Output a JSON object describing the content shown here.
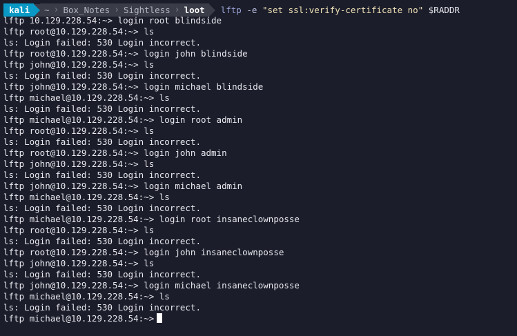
{
  "prompt": {
    "user": "kali",
    "path": [
      "~",
      "Box_Notes",
      "Sightless"
    ],
    "current_dir": "loot",
    "command": "lftp",
    "flag": "-e",
    "argument": "\"set ssl:verify-certificate no\"",
    "variable": "$RADDR"
  },
  "lines": [
    "lftp 10.129.228.54:~> login root blindside",
    "lftp root@10.129.228.54:~> ls",
    "ls: Login failed: 530 Login incorrect.",
    "lftp root@10.129.228.54:~> login john blindside",
    "lftp john@10.129.228.54:~> ls",
    "ls: Login failed: 530 Login incorrect.",
    "lftp john@10.129.228.54:~> login michael blindside",
    "lftp michael@10.129.228.54:~> ls",
    "ls: Login failed: 530 Login incorrect.",
    "lftp michael@10.129.228.54:~> login root admin",
    "lftp root@10.129.228.54:~> ls",
    "ls: Login failed: 530 Login incorrect.",
    "lftp root@10.129.228.54:~> login john admin",
    "lftp john@10.129.228.54:~> ls",
    "ls: Login failed: 530 Login incorrect.",
    "lftp john@10.129.228.54:~> login michael admin",
    "lftp michael@10.129.228.54:~> ls",
    "ls: Login failed: 530 Login incorrect.",
    "lftp michael@10.129.228.54:~> login root insaneclownposse",
    "lftp root@10.129.228.54:~> ls",
    "ls: Login failed: 530 Login incorrect.",
    "lftp root@10.129.228.54:~> login john insaneclownposse",
    "lftp john@10.129.228.54:~> ls",
    "ls: Login failed: 530 Login incorrect.",
    "lftp john@10.129.228.54:~> login michael insaneclownposse",
    "lftp michael@10.129.228.54:~> ls",
    "ls: Login failed: 530 Login incorrect."
  ],
  "current_prompt": "lftp michael@10.129.228.54:~>",
  "colors": {
    "background": "#1b1d2a",
    "user_segment": "#0a98c4",
    "path_segment": "#3a3c48",
    "text": "#e8e8ee"
  }
}
